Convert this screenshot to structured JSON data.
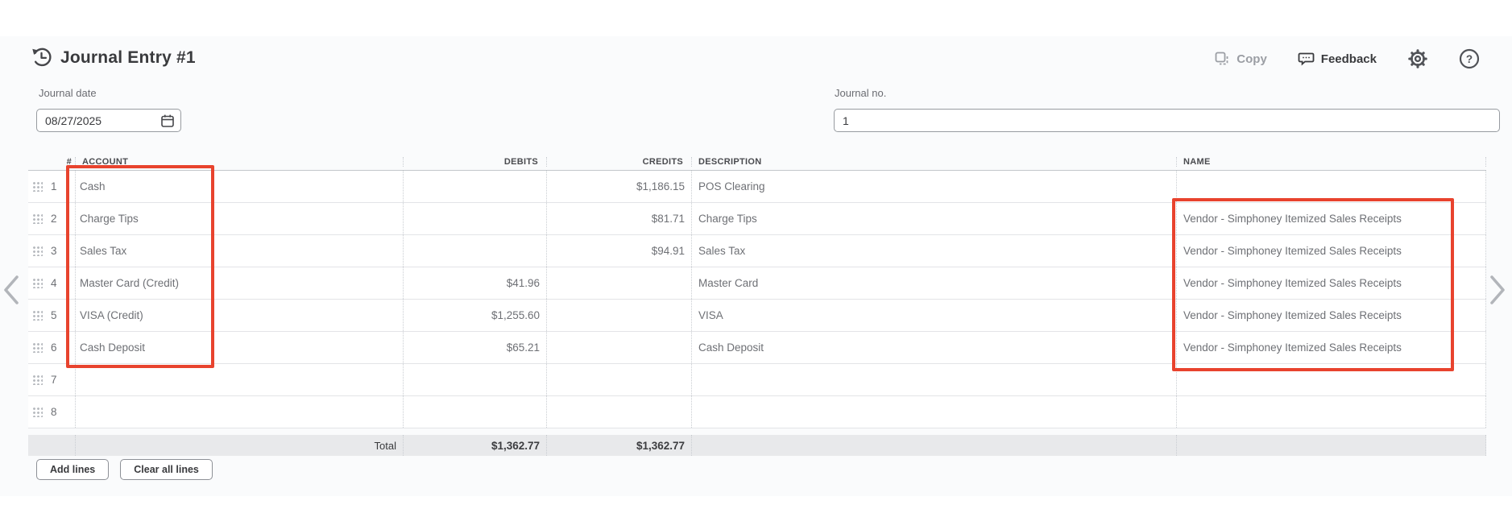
{
  "header": {
    "title": "Journal Entry #1",
    "copy_label": "Copy",
    "feedback_label": "Feedback"
  },
  "fields": {
    "journal_date": {
      "label": "Journal date",
      "value": "08/27/2025"
    },
    "journal_no": {
      "label": "Journal no.",
      "value": "1"
    }
  },
  "table": {
    "columns": [
      "#",
      "ACCOUNT",
      "DEBITS",
      "CREDITS",
      "DESCRIPTION",
      "NAME"
    ],
    "rows": [
      {
        "num": "1",
        "account": "Cash",
        "debits": "",
        "credits": "$1,186.15",
        "description": "POS Clearing",
        "name": ""
      },
      {
        "num": "2",
        "account": "Charge Tips",
        "debits": "",
        "credits": "$81.71",
        "description": "Charge Tips",
        "name": "Vendor - Simphoney Itemized Sales Receipts"
      },
      {
        "num": "3",
        "account": "Sales Tax",
        "debits": "",
        "credits": "$94.91",
        "description": "Sales Tax",
        "name": "Vendor - Simphoney Itemized Sales Receipts"
      },
      {
        "num": "4",
        "account": "Master Card (Credit)",
        "debits": "$41.96",
        "credits": "",
        "description": "Master Card",
        "name": "Vendor - Simphoney Itemized Sales Receipts"
      },
      {
        "num": "5",
        "account": "VISA (Credit)",
        "debits": "$1,255.60",
        "credits": "",
        "description": "VISA",
        "name": "Vendor - Simphoney Itemized Sales Receipts"
      },
      {
        "num": "6",
        "account": "Cash Deposit",
        "debits": "$65.21",
        "credits": "",
        "description": "Cash Deposit",
        "name": "Vendor - Simphoney Itemized Sales Receipts"
      },
      {
        "num": "7",
        "account": "",
        "debits": "",
        "credits": "",
        "description": "",
        "name": ""
      },
      {
        "num": "8",
        "account": "",
        "debits": "",
        "credits": "",
        "description": "",
        "name": ""
      }
    ],
    "total": {
      "label": "Total",
      "debits": "$1,362.77",
      "credits": "$1,362.77"
    }
  },
  "buttons": {
    "add_lines": "Add lines",
    "clear_all_lines": "Clear all lines"
  },
  "annotations": {
    "highlight_color": "#e8432e"
  }
}
